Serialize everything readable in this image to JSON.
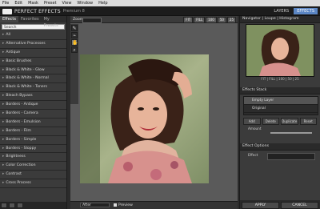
{
  "menu": {
    "items": [
      "File",
      "Edit",
      "Mask",
      "Preset",
      "View",
      "Window",
      "Help"
    ]
  },
  "app": {
    "title": "PERFECT EFFECTS",
    "subtitle": "Premium 8",
    "top_tabs": [
      "LAYERS",
      "EFFECTS"
    ],
    "active_top_tab": "EFFECTS"
  },
  "left_panel": {
    "tabs": [
      "Effects",
      "Favorites",
      "My Presets"
    ],
    "active_tab": "Effects",
    "search_value": "Search",
    "effects": [
      "All",
      "Alternative Processes",
      "Antique",
      "Basic Brushes",
      "Black & White - Glow",
      "Black & White - Normal",
      "Black & White - Toners",
      "Bleach Bypass",
      "Borders - Antique",
      "Borders - Camera",
      "Borders - Emulsion",
      "Borders - Film",
      "Borders - Simple",
      "Borders - Sloppy",
      "Brightness",
      "Color Correction",
      "Contrast",
      "Cross Process"
    ]
  },
  "center": {
    "zoom_label": "Zoom",
    "view_buttons": [
      "FIT",
      "FILL",
      "100",
      "50",
      "25"
    ],
    "tools": [
      "brush-icon",
      "masking-icon",
      "hand-icon",
      "zoom-icon"
    ],
    "after_label": "After",
    "preview_label": "Preview"
  },
  "right_panel": {
    "navigator_title": "Navigator | Loupe | Histogram",
    "nav_zoom_levels": "FIT | FILL | 100 | 50 | 25",
    "effects_stack_title": "Effects Stack",
    "stack_rows": [
      "Empty Layer",
      "Original"
    ],
    "stack_buttons": [
      "Add",
      "Delete",
      "Duplicate",
      "Reset"
    ],
    "amount_label": "Amount",
    "amount_value": 100,
    "effect_options_title": "Effect Options",
    "effect_label": "Effect",
    "apply_label": "APPLY",
    "cancel_label": "CANCEL"
  },
  "colors": {
    "accent": "#5b86c4",
    "panel_bg": "#3b3b3b",
    "dark_bg": "#2b2b2b"
  }
}
